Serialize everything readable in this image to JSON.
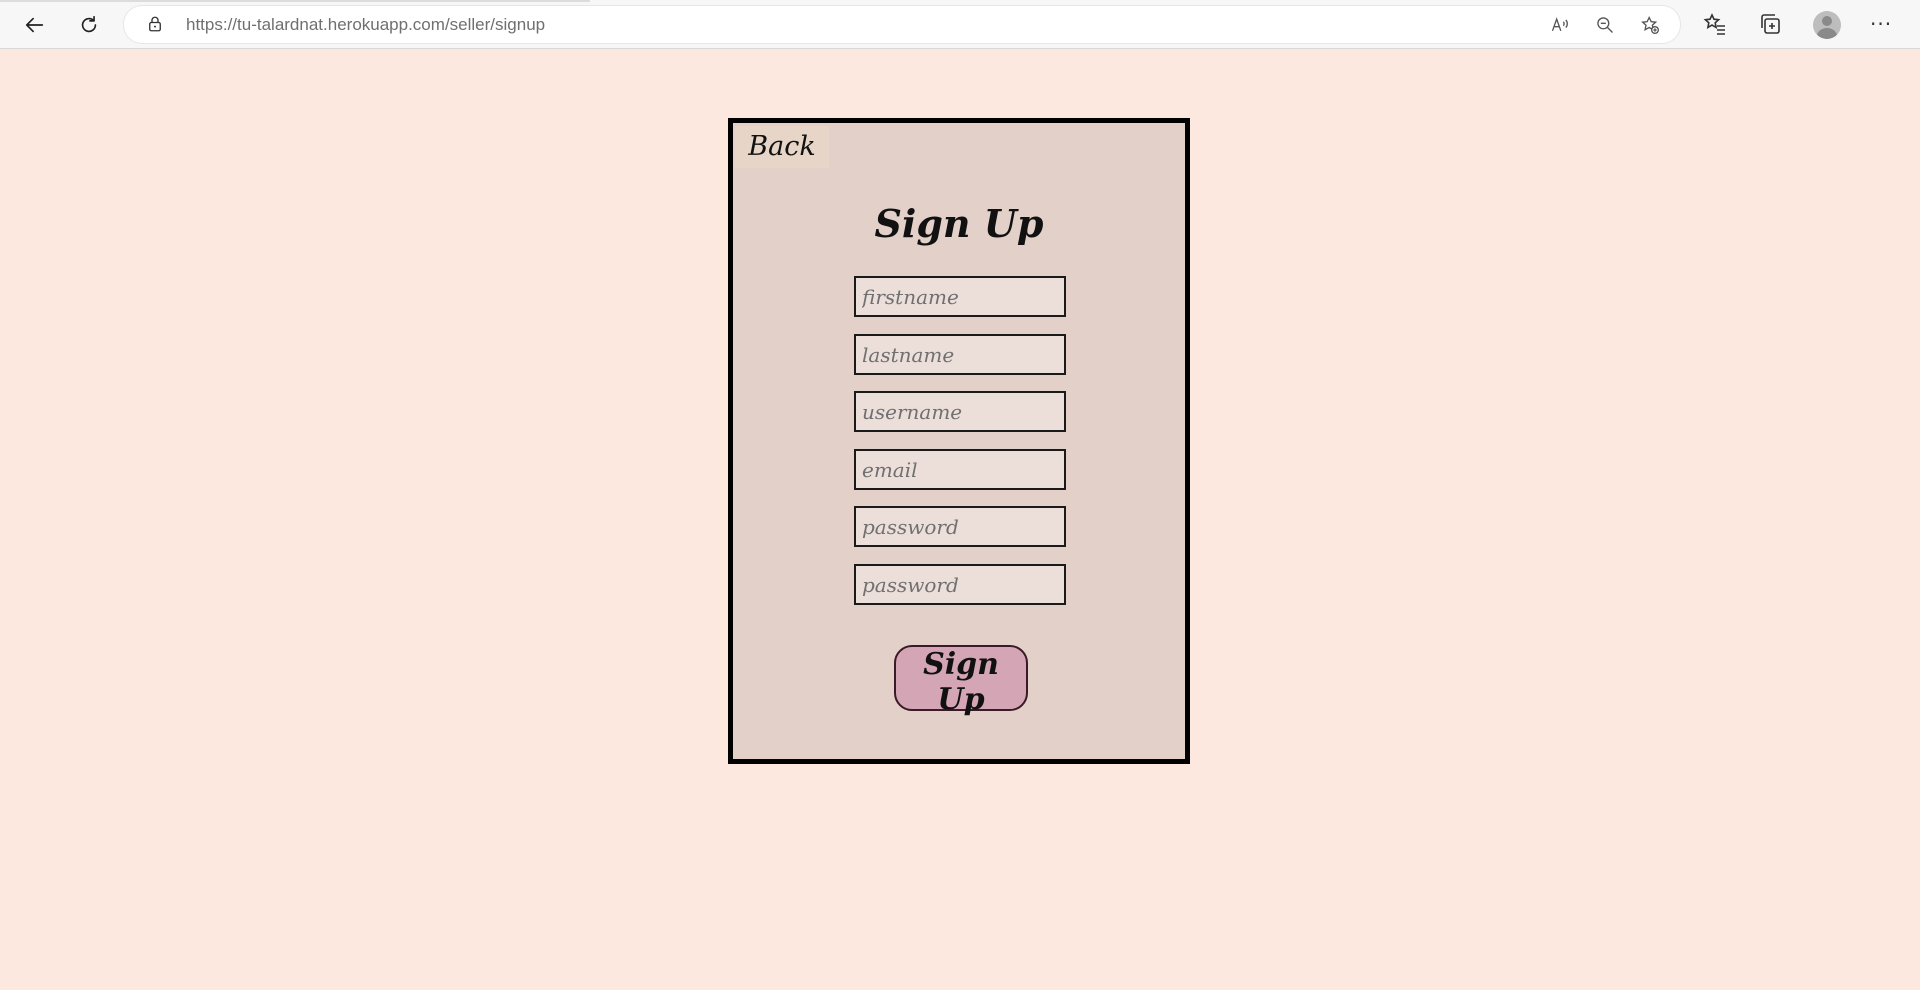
{
  "browser": {
    "url_host": "https://tu-talardnat.herokuapp.com",
    "url_path": "/seller/signup",
    "more_label": "···"
  },
  "page": {
    "back_label": "Back",
    "title": "Sign Up",
    "fields": {
      "firstname_placeholder": "firstname",
      "lastname_placeholder": "lastname",
      "username_placeholder": "username",
      "email_placeholder": "email",
      "password_placeholder": "password",
      "confirm_password_placeholder": "password"
    },
    "submit_label": "Sign Up"
  },
  "colors": {
    "page_background": "#fde8e0",
    "card_background": "#e3d1c9",
    "submit_background": "#d4a5b4"
  }
}
